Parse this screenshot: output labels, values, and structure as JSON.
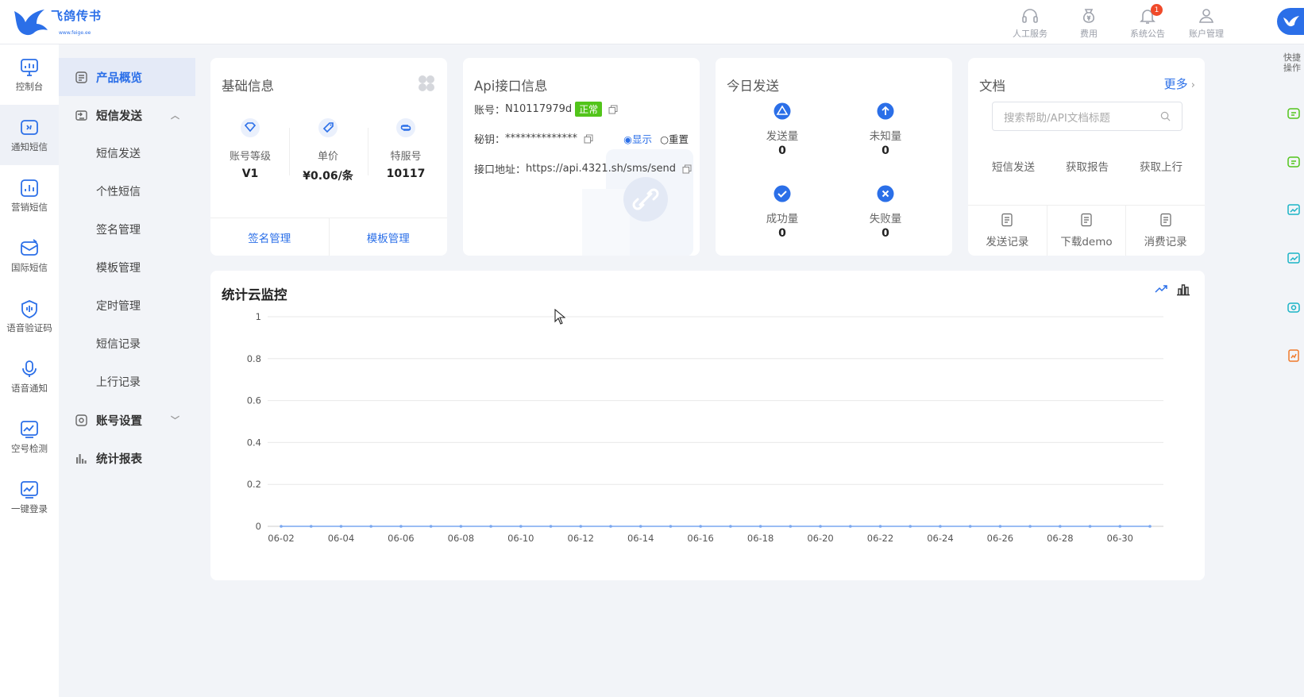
{
  "header": {
    "logo_text": "飞鸽传书",
    "logo_sub": "www.feige.ee",
    "actions": [
      {
        "label": "人工服务",
        "icon": "headset-icon"
      },
      {
        "label": "费用",
        "icon": "money-bag-icon"
      },
      {
        "label": "系统公告",
        "icon": "bell-icon",
        "badge": "1"
      },
      {
        "label": "账户管理",
        "icon": "user-icon"
      }
    ]
  },
  "rail": [
    {
      "label": "控制台",
      "icon": "dashboard-icon"
    },
    {
      "label": "通知短信",
      "icon": "notify-sms-icon"
    },
    {
      "label": "营销短信",
      "icon": "marketing-sms-icon"
    },
    {
      "label": "国际短信",
      "icon": "international-sms-icon"
    },
    {
      "label": "语音验证码",
      "icon": "voice-code-icon"
    },
    {
      "label": "语音通知",
      "icon": "microphone-icon"
    },
    {
      "label": "空号检测",
      "icon": "number-check-icon"
    },
    {
      "label": "一键登录",
      "icon": "one-click-login-icon"
    }
  ],
  "submenu": {
    "overview": "产品概览",
    "sms_send": "短信发送",
    "items": [
      "短信发送",
      "个性短信",
      "签名管理",
      "模板管理",
      "定时管理",
      "短信记录",
      "上行记录"
    ],
    "account_settings": "账号设置",
    "reports": "统计报表"
  },
  "basic_info": {
    "title": "基础信息",
    "level_label": "账号等级",
    "level_value": "V1",
    "price_label": "单价",
    "price_value": "¥0.06/条",
    "service_label": "特服号",
    "service_value": "10117",
    "footer_left": "签名管理",
    "footer_right": "模板管理"
  },
  "api_info": {
    "title": "Api接口信息",
    "account_label": "账号：",
    "account_value": "N10117979d",
    "status": "正常",
    "secret_label": "秘钥：",
    "secret_value": "**************",
    "show_label": "显示",
    "reset_label": "重置",
    "url_label": "接口地址：",
    "url_value": "https://api.4321.sh/sms/send"
  },
  "today": {
    "title": "今日发送",
    "sent_label": "发送量",
    "sent_value": "0",
    "unknown_label": "未知量",
    "unknown_value": "0",
    "success_label": "成功量",
    "success_value": "0",
    "fail_label": "失败量",
    "fail_value": "0"
  },
  "docs": {
    "title": "文档",
    "more": "更多",
    "search_placeholder": "搜索帮助/API文档标题",
    "links": [
      "短信发送",
      "获取报告",
      "获取上行"
    ],
    "footer": [
      "发送记录",
      "下载demo",
      "消费记录"
    ]
  },
  "monitor": {
    "title": "统计云监控"
  },
  "right_float": {
    "label": "快捷操作"
  },
  "colors": {
    "primary": "#2b6fe8",
    "success": "#52c41a",
    "badge": "#f04a2a",
    "line": "#7aa7f0"
  },
  "chart_data": {
    "type": "line",
    "title": "",
    "x": [
      "06-02",
      "06-03",
      "06-04",
      "06-05",
      "06-06",
      "06-07",
      "06-08",
      "06-09",
      "06-10",
      "06-11",
      "06-12",
      "06-13",
      "06-14",
      "06-15",
      "06-16",
      "06-17",
      "06-18",
      "06-19",
      "06-20",
      "06-21",
      "06-22",
      "06-23",
      "06-24",
      "06-25",
      "06-26",
      "06-27",
      "06-28",
      "06-29",
      "06-30",
      "07-01"
    ],
    "x_tick_labels": [
      "06-02",
      "06-04",
      "06-06",
      "06-08",
      "06-10",
      "06-12",
      "06-14",
      "06-16",
      "06-18",
      "06-20",
      "06-22",
      "06-24",
      "06-26",
      "06-28",
      "06-30"
    ],
    "series": [
      {
        "values": [
          0,
          0,
          0,
          0,
          0,
          0,
          0,
          0,
          0,
          0,
          0,
          0,
          0,
          0,
          0,
          0,
          0,
          0,
          0,
          0,
          0,
          0,
          0,
          0,
          0,
          0,
          0,
          0,
          0,
          0
        ]
      }
    ],
    "ylim": [
      0,
      1
    ],
    "yticks": [
      0,
      0.2,
      0.4,
      0.6,
      0.8,
      1
    ],
    "grid": true
  }
}
